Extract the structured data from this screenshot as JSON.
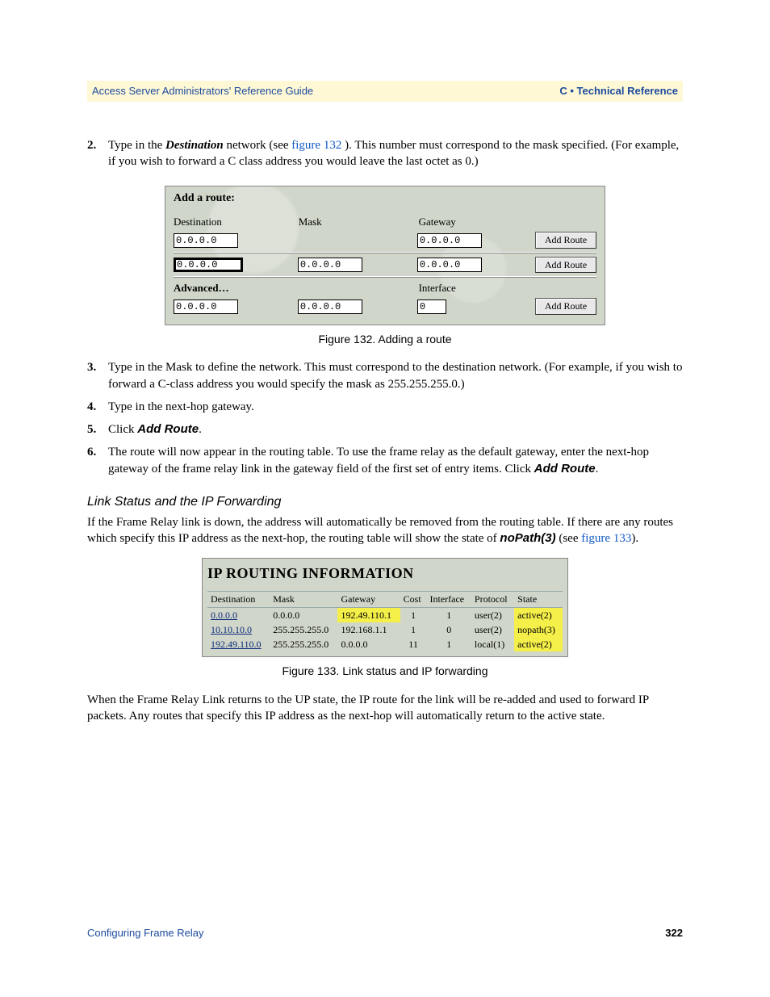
{
  "header": {
    "left": "Access Server Administrators' Reference Guide",
    "right": "C • Technical Reference"
  },
  "list": {
    "i2": {
      "num": "2.",
      "pre": "Type in the ",
      "dest": "Destination",
      "mid": " network (see ",
      "link": "figure 132",
      "post": "). This number must correspond to the mask specified. (For example, if you wish to forward a C class address you would leave the last octet as 0.)"
    },
    "i3": {
      "num": "3.",
      "text": "Type in the Mask to define the network. This must correspond to the destination network. (For example, if you wish to forward a C-class address you would specify the mask as 255.255.255.0.)"
    },
    "i4": {
      "num": "4.",
      "text": "Type in the next-hop gateway."
    },
    "i5": {
      "num": "5.",
      "pre": "Click ",
      "btn": "Add Route",
      "post": "."
    },
    "i6": {
      "num": "6.",
      "pre": "The route will now appear in the routing table. To use the frame relay as the default gateway, enter the next-hop gateway of the frame relay link in the gateway field of the first set of entry items. Click ",
      "btn": "Add Route",
      "post": "."
    }
  },
  "fig132": {
    "title": "Add a route:",
    "labels": {
      "dest": "Destination",
      "mask": "Mask",
      "gateway": "Gateway",
      "interface": "Interface",
      "adv": "Advanced…"
    },
    "rows": {
      "r1": {
        "dest": "0.0.0.0",
        "mask": "",
        "gateway": "0.0.0.0",
        "btn": "Add Route"
      },
      "r2": {
        "dest": "0.0.0.0",
        "mask": "0.0.0.0",
        "gateway": "0.0.0.0",
        "btn": "Add Route"
      },
      "r3": {
        "dest": "0.0.0.0",
        "mask": "0.0.0.0",
        "iface": "0",
        "btn": "Add Route"
      }
    },
    "caption": "Figure 132. Adding a route"
  },
  "section": {
    "title": "Link Status and the IP Forwarding",
    "p1_pre": "If the Frame Relay link is down, the address will automatically be removed from the routing table. If there are any routes which specify this IP address as the next-hop, the routing table will show the state of ",
    "p1_bold": "noPath(3)",
    "p1_mid": " (see ",
    "p1_link": "figure 133",
    "p1_post": ")."
  },
  "fig133": {
    "title": "IP ROUTING INFORMATION",
    "headers": [
      "Destination",
      "Mask",
      "Gateway",
      "Cost",
      "Interface",
      "Protocol",
      "State"
    ],
    "rows": [
      {
        "dest": "0.0.0.0",
        "mask": "0.0.0.0",
        "gw": "192.49.110.1",
        "cost": "1",
        "iface": "1",
        "proto": "user(2)",
        "state": "active(2)",
        "hl_gw": true,
        "hl_state": true
      },
      {
        "dest": "10.10.10.0",
        "mask": "255.255.255.0",
        "gw": "192.168.1.1",
        "cost": "1",
        "iface": "0",
        "proto": "user(2)",
        "state": "nopath(3)",
        "hl_state": true
      },
      {
        "dest": "192.49.110.0",
        "mask": "255.255.255.0",
        "gw": "0.0.0.0",
        "cost": "11",
        "iface": "1",
        "proto": "local(1)",
        "state": "active(2)",
        "hl_state": true
      }
    ],
    "caption": "Figure 133. Link status and IP forwarding"
  },
  "closing": "When the Frame Relay Link returns to the UP state, the IP route for the link will be re-added and used to forward IP packets. Any routes that specify this IP address as the next-hop will automatically return to the active state.",
  "footer": {
    "left": "Configuring Frame Relay",
    "right": "322"
  }
}
